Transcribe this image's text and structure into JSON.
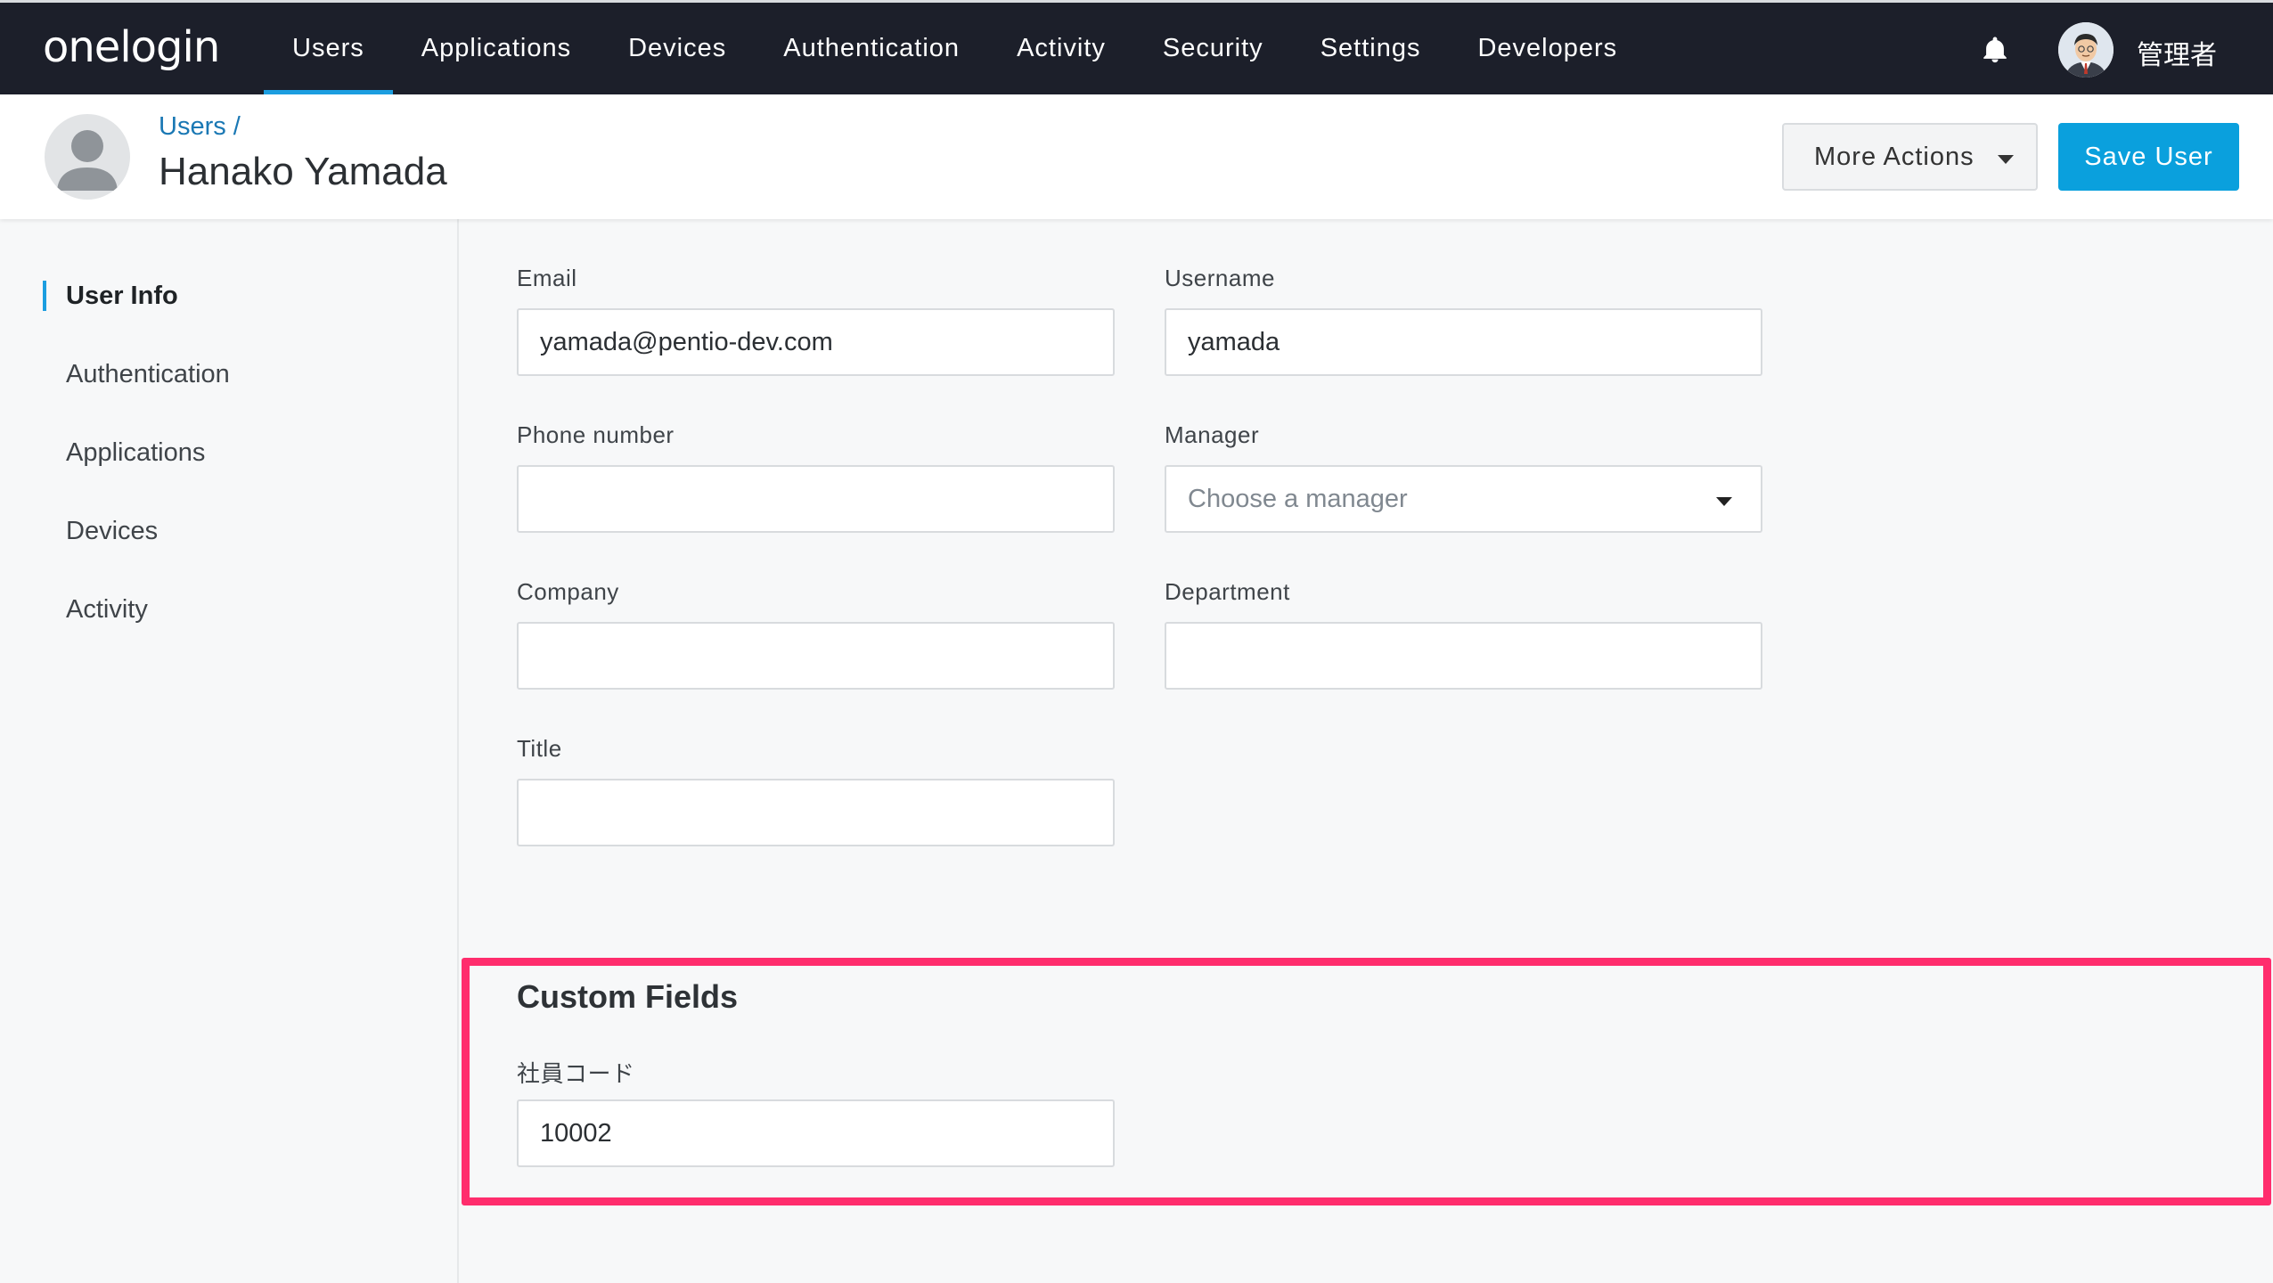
{
  "brand": {
    "logo_text": "onelogin"
  },
  "topnav": {
    "items": [
      {
        "label": "Users",
        "active": true
      },
      {
        "label": "Applications"
      },
      {
        "label": "Devices"
      },
      {
        "label": "Authentication"
      },
      {
        "label": "Activity"
      },
      {
        "label": "Security"
      },
      {
        "label": "Settings"
      },
      {
        "label": "Developers"
      }
    ],
    "user_name": "管理者"
  },
  "header": {
    "breadcrumb": "Users /",
    "title": "Hanako Yamada",
    "more_actions_label": "More Actions",
    "save_label": "Save User"
  },
  "sidebar": {
    "items": [
      {
        "label": "User Info",
        "active": true
      },
      {
        "label": "Authentication"
      },
      {
        "label": "Applications"
      },
      {
        "label": "Devices"
      },
      {
        "label": "Activity"
      }
    ]
  },
  "form": {
    "email": {
      "label": "Email",
      "value": "yamada@pentio-dev.com"
    },
    "username": {
      "label": "Username",
      "value": "yamada"
    },
    "phone": {
      "label": "Phone number",
      "value": ""
    },
    "manager": {
      "label": "Manager",
      "placeholder": "Choose a manager"
    },
    "company": {
      "label": "Company",
      "value": ""
    },
    "department": {
      "label": "Department",
      "value": ""
    },
    "title": {
      "label": "Title",
      "value": ""
    }
  },
  "custom_fields": {
    "section_title": "Custom Fields",
    "employee_code": {
      "label": "社員コード",
      "value": "10002"
    }
  },
  "colors": {
    "topnav_bg": "#1c1f2a",
    "accent": "#1c9ee0",
    "save_button": "#0aa0dd",
    "highlight": "#ff2d6d"
  }
}
